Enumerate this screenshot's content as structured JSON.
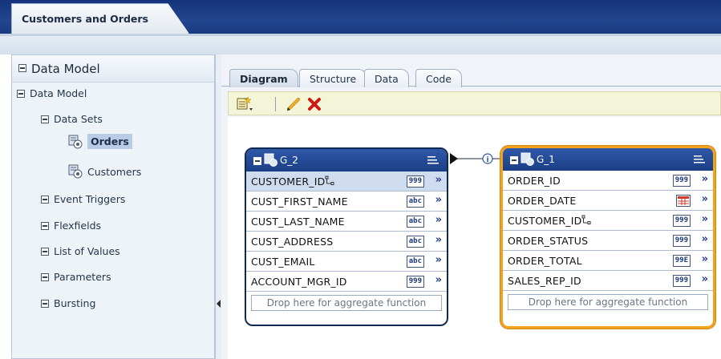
{
  "header": {
    "doc_tab": "Customers and Orders"
  },
  "left_panel": {
    "title": "Data Model",
    "tree": [
      {
        "label": "Data Model",
        "kind": "node"
      },
      {
        "label": "Data Sets",
        "kind": "node"
      },
      {
        "label": "Orders",
        "kind": "dataset",
        "selected": true
      },
      {
        "label": "Customers",
        "kind": "dataset"
      },
      {
        "label": "Event Triggers",
        "kind": "node"
      },
      {
        "label": "Flexfields",
        "kind": "node"
      },
      {
        "label": "List of Values",
        "kind": "node"
      },
      {
        "label": "Parameters",
        "kind": "node"
      },
      {
        "label": "Bursting",
        "kind": "node"
      }
    ]
  },
  "tabs": [
    "Diagram",
    "Structure",
    "Data",
    "Code"
  ],
  "active_tab": "Diagram",
  "toolbar": {
    "icons": [
      "new-dataset-icon",
      "edit-icon",
      "delete-icon"
    ]
  },
  "groups": [
    {
      "name": "G_2",
      "fields": [
        {
          "name": "CUSTOMER_ID",
          "type": "999",
          "key": true,
          "selected": true
        },
        {
          "name": "CUST_FIRST_NAME",
          "type": "abc"
        },
        {
          "name": "CUST_LAST_NAME",
          "type": "abc"
        },
        {
          "name": "CUST_ADDRESS",
          "type": "abc"
        },
        {
          "name": "CUST_EMAIL",
          "type": "abc"
        },
        {
          "name": "ACCOUNT_MGR_ID",
          "type": "999"
        }
      ],
      "aggregate_hint": "Drop here for aggregate function"
    },
    {
      "name": "G_1",
      "fields": [
        {
          "name": "ORDER_ID",
          "type": "999"
        },
        {
          "name": "ORDER_DATE",
          "type": "date"
        },
        {
          "name": "CUSTOMER_ID",
          "type": "999",
          "key": true
        },
        {
          "name": "ORDER_STATUS",
          "type": "999"
        },
        {
          "name": "ORDER_TOTAL",
          "type": "99E"
        },
        {
          "name": "SALES_REP_ID",
          "type": "999"
        }
      ],
      "aggregate_hint": "Drop here for aggregate function"
    }
  ],
  "colors": {
    "header": "#1b3f86",
    "selected_group_border": "#f2a31b",
    "toolbar": "#f4f4d8"
  }
}
